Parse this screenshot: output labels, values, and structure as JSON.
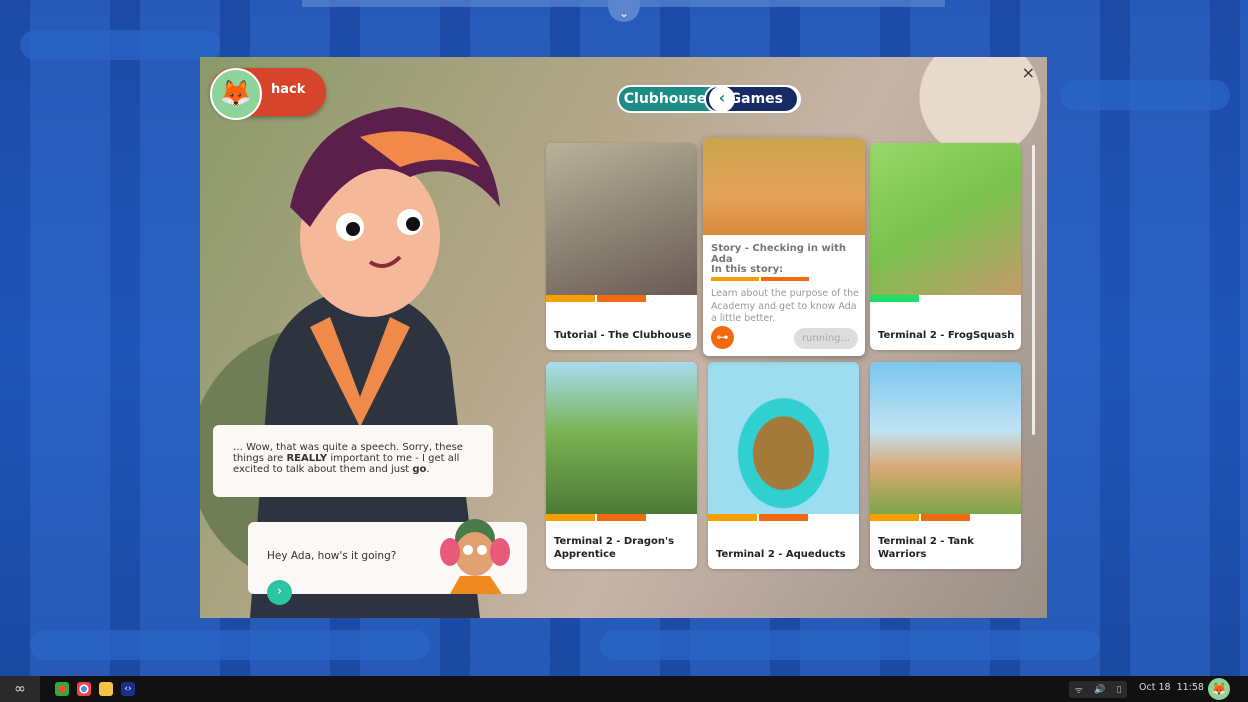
{
  "window": {
    "close_icon": "×"
  },
  "user": {
    "name": "hack"
  },
  "toggle": {
    "left": "Clubhouse",
    "right": "Games"
  },
  "dialog": {
    "ada_parts": [
      "… Wow, that was quite a speech. Sorry, these things are ",
      "REALLY",
      " important to me -  I get all excited to talk about them and just ",
      "go",
      "."
    ],
    "reply": "Hey Ada, how's it going?"
  },
  "cards": [
    {
      "title": "Tutorial - The Clubhouse"
    },
    {
      "title": "Terminal 2 - FrogSquash"
    },
    {
      "title": "Terminal 2 - Dragon's Apprentice"
    },
    {
      "title": "Terminal 2 - Aqueducts"
    },
    {
      "title": "Terminal 2 - Tank Warriors"
    }
  ],
  "story": {
    "title": "Story - Checking in with Ada",
    "in_this_story": "In this story:",
    "description": "Learn about the purpose of the Academy and get to know Ada a little better.",
    "status": "running..."
  },
  "taskbar": {
    "date": "Oct 18",
    "time": "11:58"
  },
  "colors": {
    "accent_teal": "#1e8c86",
    "orange": "#f26a10",
    "yellow": "#f5a000",
    "green": "#22dd66",
    "desktop": "#1d4fae"
  }
}
